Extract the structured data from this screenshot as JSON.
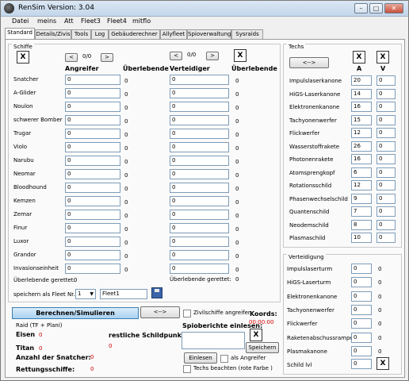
{
  "window": {
    "title": "RenSim Version: 3.04",
    "buttons": [
      "–",
      "□",
      "✕"
    ]
  },
  "menu": [
    "Datei",
    "meins",
    "Att",
    "Fleet3",
    "Fleet4",
    "mitflo"
  ],
  "tabs": [
    "Standard",
    "Details/Zivis",
    "Tools",
    "Log",
    "Gebäuderechner",
    "Allyfleet",
    "Spioverwaltung",
    "Sysraids"
  ],
  "schiffe": {
    "header": "Schiffe",
    "x_label": "X",
    "nav_prev": "<",
    "nav_next": ">",
    "att_counter": "0/0",
    "def_counter": "0/0",
    "col_angreifer": "Angreifer",
    "col_ueberlebende_att": "Überlebende",
    "col_verteidiger": "Verteidiger",
    "col_ueberlebende_def": "Überlebende",
    "rows": [
      {
        "name": "Snatcher",
        "att": "0",
        "att_surv": "0",
        "def": "0",
        "def_surv": "0"
      },
      {
        "name": "A-Glider",
        "att": "0",
        "att_surv": "0",
        "def": "0",
        "def_surv": "0"
      },
      {
        "name": "Noulon",
        "att": "0",
        "att_surv": "0",
        "def": "0",
        "def_surv": "0"
      },
      {
        "name": "schwerer Bomber",
        "att": "0",
        "att_surv": "0",
        "def": "0",
        "def_surv": "0"
      },
      {
        "name": "Trugar",
        "att": "0",
        "att_surv": "0",
        "def": "0",
        "def_surv": "0"
      },
      {
        "name": "Violo",
        "att": "0",
        "att_surv": "0",
        "def": "0",
        "def_surv": "0"
      },
      {
        "name": "Narubu",
        "att": "0",
        "att_surv": "0",
        "def": "0",
        "def_surv": "0"
      },
      {
        "name": "Neomar",
        "att": "0",
        "att_surv": "0",
        "def": "0",
        "def_surv": "0"
      },
      {
        "name": "Bloodhound",
        "att": "0",
        "att_surv": "0",
        "def": "0",
        "def_surv": "0"
      },
      {
        "name": "Kemzen",
        "att": "0",
        "att_surv": "0",
        "def": "0",
        "def_surv": "0"
      },
      {
        "name": "Zemar",
        "att": "0",
        "att_surv": "0",
        "def": "0",
        "def_surv": "0"
      },
      {
        "name": "Finur",
        "att": "0",
        "att_surv": "0",
        "def": "0",
        "def_surv": "0"
      },
      {
        "name": "Luxor",
        "att": "0",
        "att_surv": "0",
        "def": "0",
        "def_surv": "0"
      },
      {
        "name": "Grandor",
        "att": "0",
        "att_surv": "0",
        "def": "0",
        "def_surv": "0"
      },
      {
        "name": "Invasionseinheit",
        "att": "0",
        "att_surv": "0",
        "def": "0",
        "def_surv": "0"
      }
    ],
    "att_gerettet_label": "Überlebende gerettet:",
    "att_gerettet_value": "0",
    "def_gerettet_label": "Überlebende gerettet:",
    "def_gerettet_value": "0",
    "speichern_label": "speichern als Fleet Nr.:",
    "fleet_nr": "1",
    "fleet_name": "Fleet1"
  },
  "techs": {
    "header": "Techs",
    "swap": "<-->",
    "x_label": "X",
    "col_a": "A",
    "col_v": "V",
    "rows": [
      {
        "name": "Impulslaserkanone",
        "a": "20",
        "v": "0"
      },
      {
        "name": "HiGS-Laserkanone",
        "a": "14",
        "v": "0"
      },
      {
        "name": "Elektronenkanone",
        "a": "16",
        "v": "0"
      },
      {
        "name": "Tachyonenwerfer",
        "a": "15",
        "v": "0"
      },
      {
        "name": "Flickwerfer",
        "a": "12",
        "v": "0"
      },
      {
        "name": "Wasserstoffrakete",
        "a": "26",
        "v": "0"
      },
      {
        "name": "Photonenrakete",
        "a": "16",
        "v": "0"
      },
      {
        "name": "Atomsprengkopf",
        "a": "6",
        "v": "0"
      },
      {
        "name": "Rotationsschild",
        "a": "12",
        "v": "0"
      },
      {
        "name": "Phasenwechselschild",
        "a": "9",
        "v": "0"
      },
      {
        "name": "Quantenschild",
        "a": "7",
        "v": "0"
      },
      {
        "name": "Neodemschild",
        "a": "8",
        "v": "0"
      },
      {
        "name": "Plasmaschild",
        "a": "10",
        "v": "0"
      }
    ]
  },
  "verteidigung": {
    "header": "Verteidigung",
    "rows": [
      {
        "name": "Impulslaserturm",
        "val": "0",
        "surv": "0"
      },
      {
        "name": "HiGS-Laserturm",
        "val": "0",
        "surv": "0"
      },
      {
        "name": "Elektronenkanone",
        "val": "0",
        "surv": "0"
      },
      {
        "name": "Tachyonenwerfer",
        "val": "0",
        "surv": "0"
      },
      {
        "name": "Flickwerfer",
        "val": "0",
        "surv": "0"
      },
      {
        "name": "Raketenabschussrampe",
        "val": "0",
        "surv": "0"
      },
      {
        "name": "Plasmakanone",
        "val": "0",
        "surv": "0"
      }
    ],
    "schild_label": "Schild lvl",
    "schild_value": "0",
    "x_label": "X"
  },
  "bottom": {
    "calc_button": "Berechnen/Simulieren",
    "swap_button": "<-->",
    "zivi_label": "Zivilschiffe angreifen",
    "koords_label": "Koords:",
    "koords_value": "00:00:00",
    "raid_label": "Raid (TF + Plani)",
    "eisen_label": "Eisen",
    "eisen_value": "0",
    "titan_label": "Titan",
    "titan_value": "0",
    "schild_label": "restliche Schildpunkte:",
    "schild_value": "0",
    "spio_label": "Spioberichte einlesen:",
    "x_label": "X",
    "speichern_button": "Speichern",
    "einlesen_button": "Einlesen",
    "als_angreifer_label": "als Angreifer",
    "techs_beachten_label": "Techs beachten (rote Farbe )",
    "snatcher_label": "Anzahl der Snatcher:",
    "snatcher_value": "0",
    "rettung_label": "Rettungsschiffe:",
    "rettung_value": "0"
  },
  "colors": {
    "accent": "#d00000",
    "calc_button": "#a9d1f0",
    "input_border": "#7f9db9"
  }
}
